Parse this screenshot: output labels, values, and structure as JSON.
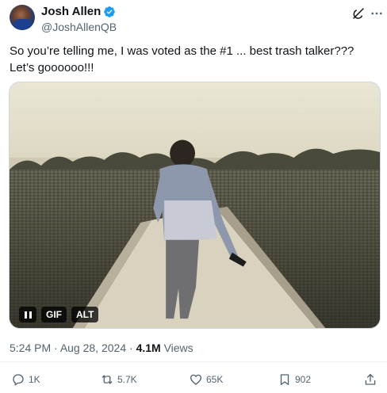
{
  "author": {
    "name": "Josh Allen",
    "handle": "@JoshAllenQB"
  },
  "tweet": {
    "text": "So you’re telling me, I was voted as the #1 ... best trash talker??? Let’s goooooo!!!"
  },
  "media": {
    "gif_badge": "GIF",
    "alt_badge": "ALT"
  },
  "meta": {
    "time": "5:24 PM",
    "separator1": " · ",
    "date": "Aug 28, 2024",
    "separator2": " · ",
    "views_count": "4.1M",
    "views_label": " Views"
  },
  "actions": {
    "replies": "1K",
    "reposts": "5.7K",
    "likes": "65K",
    "bookmarks": "902"
  },
  "icons": [
    "verified-badge-icon",
    "grok-icon",
    "more-icon",
    "pause-icon",
    "reply-icon",
    "repost-icon",
    "like-icon",
    "bookmark-icon",
    "share-icon"
  ],
  "colors": {
    "verified": "#1d9bf0",
    "text": "#0f1419",
    "secondary": "#536471"
  }
}
